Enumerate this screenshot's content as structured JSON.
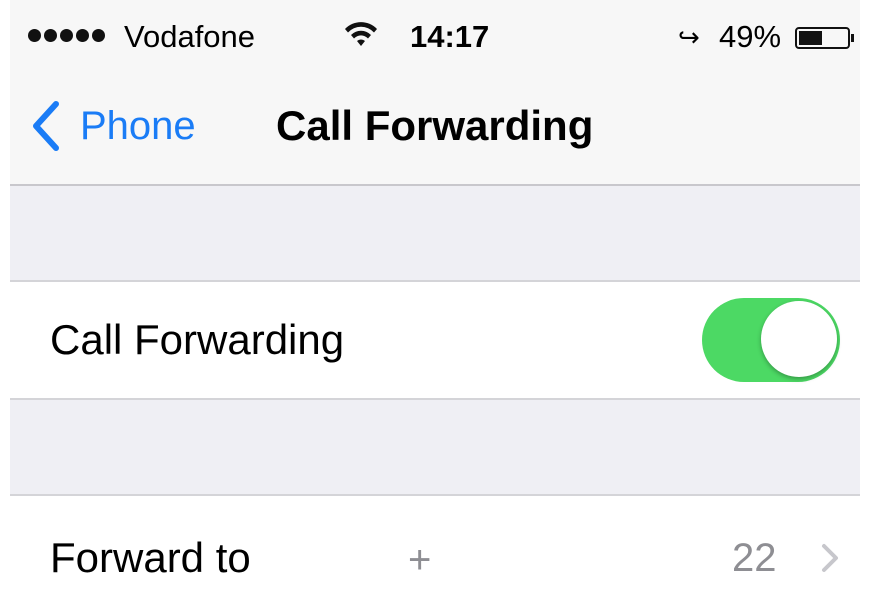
{
  "status_bar": {
    "signal_dots": 5,
    "carrier": "Vodafone",
    "wifi_icon": "wifi-icon",
    "time": "14:17",
    "call_forward_icon": "↪",
    "battery_percent": "49%",
    "battery_level": 0.49
  },
  "nav": {
    "back_label": "Phone",
    "title": "Call Forwarding",
    "accent_color": "#1a7cf6"
  },
  "settings": {
    "call_forwarding": {
      "label": "Call Forwarding",
      "enabled": true,
      "toggle_color": "#4cd964"
    },
    "forward_to": {
      "label": "Forward to",
      "number_prefix": "+",
      "number_suffix": "22"
    }
  }
}
